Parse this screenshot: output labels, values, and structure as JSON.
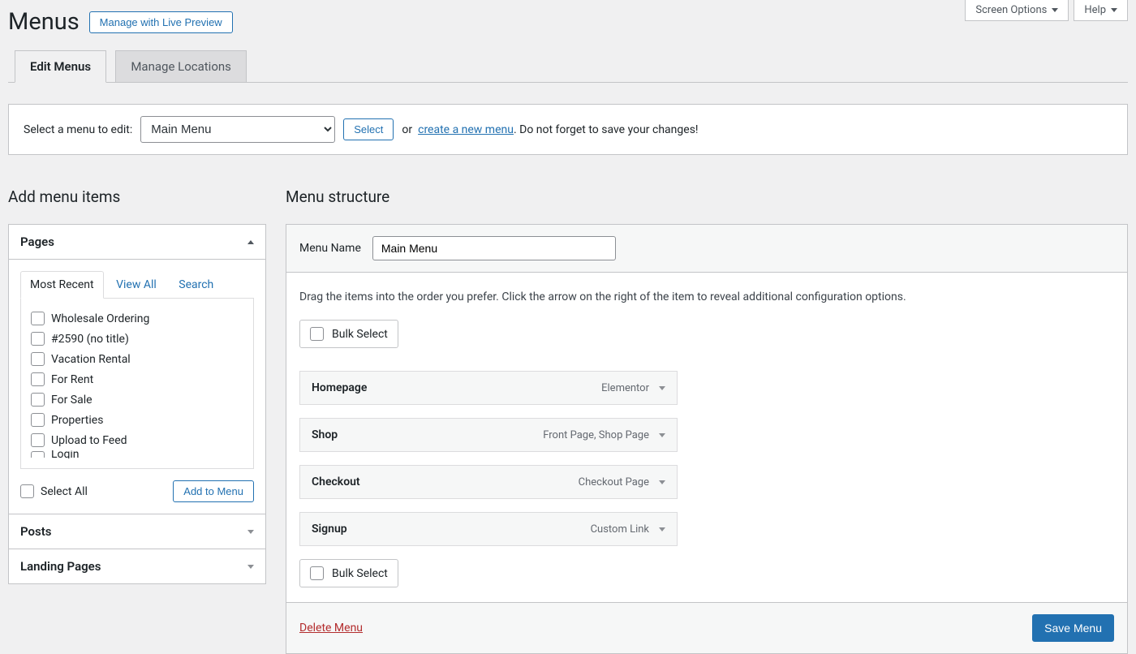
{
  "topTabs": {
    "screenOptions": "Screen Options",
    "help": "Help"
  },
  "header": {
    "title": "Menus",
    "livePreview": "Manage with Live Preview"
  },
  "navTabs": {
    "edit": "Edit Menus",
    "manage": "Manage Locations"
  },
  "selectBar": {
    "label": "Select a menu to edit:",
    "selected": "Main Menu",
    "selectBtn": "Select",
    "or": "or",
    "createLink": "create a new menu",
    "suffix": ". Do not forget to save your changes!"
  },
  "leftCol": {
    "heading": "Add menu items",
    "accordions": {
      "pages": "Pages",
      "posts": "Posts",
      "landingPages": "Landing Pages"
    },
    "innerTabs": {
      "recent": "Most Recent",
      "viewAll": "View All",
      "search": "Search"
    },
    "pageItems": [
      "Wholesale Ordering",
      "#2590 (no title)",
      "Vacation Rental",
      "For Rent",
      "For Sale",
      "Properties",
      "Upload to Feed",
      "Login"
    ],
    "selectAll": "Select All",
    "addToMenu": "Add to Menu"
  },
  "rightCol": {
    "heading": "Menu structure",
    "menuNameLabel": "Menu Name",
    "menuName": "Main Menu",
    "instruction": "Drag the items into the order you prefer. Click the arrow on the right of the item to reveal additional configuration options.",
    "bulkSelect": "Bulk Select",
    "items": [
      {
        "title": "Homepage",
        "type": "Elementor"
      },
      {
        "title": "Shop",
        "type": "Front Page, Shop Page"
      },
      {
        "title": "Checkout",
        "type": "Checkout Page"
      },
      {
        "title": "Signup",
        "type": "Custom Link"
      }
    ],
    "deleteMenu": "Delete Menu",
    "saveMenu": "Save Menu"
  }
}
